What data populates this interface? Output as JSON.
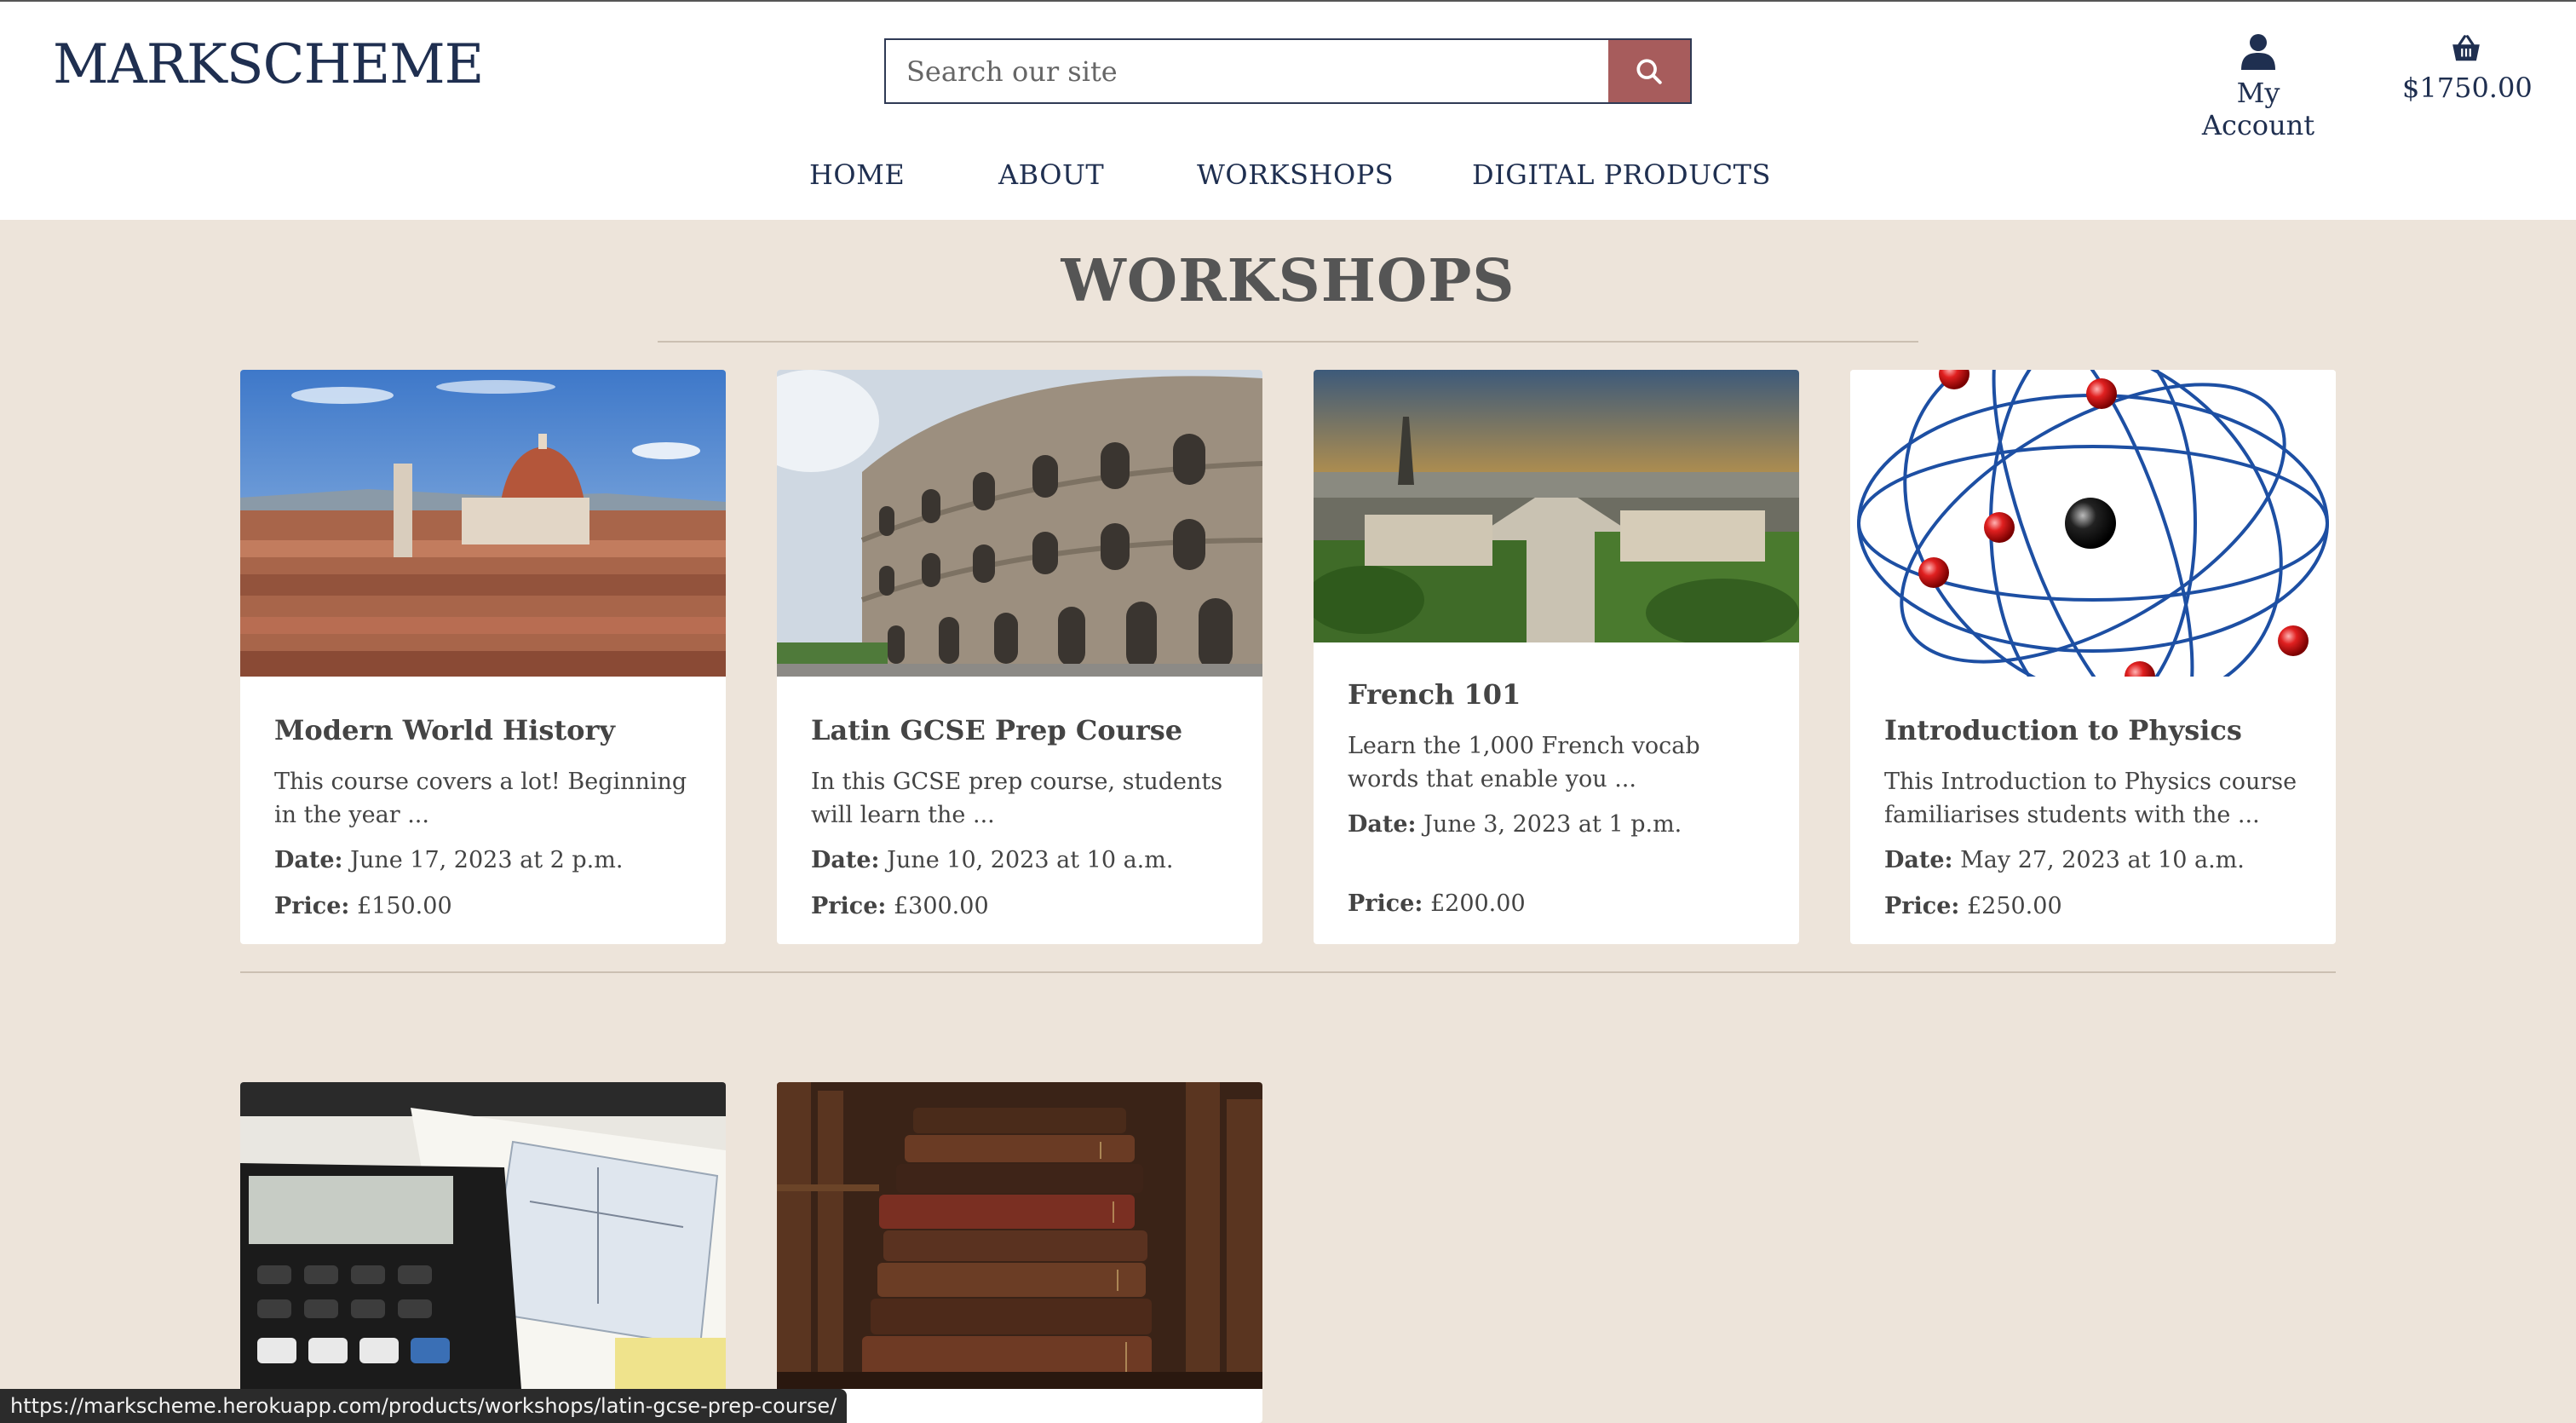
{
  "header": {
    "logo": "MARKSCHEME",
    "search_placeholder": "Search our site",
    "account_label": "My Account",
    "cart_total": "$1750.00"
  },
  "nav": [
    {
      "label": "HOME"
    },
    {
      "label": "ABOUT"
    },
    {
      "label": "WORKSHOPS"
    },
    {
      "label": "DIGITAL PRODUCTS"
    }
  ],
  "page_title": "WORKSHOPS",
  "date_label": "Date:",
  "price_label": "Price:",
  "workshops": [
    {
      "title": "Modern World History",
      "description": "This course covers a lot! Beginning in the year ...",
      "date": "June 17, 2023 at 2 p.m.",
      "price": "£150.00",
      "image": "florence-cityscape"
    },
    {
      "title": "Latin GCSE Prep Course",
      "description": "In this GCSE prep course, students will learn the ...",
      "date": "June 10, 2023 at 10 a.m.",
      "price": "£300.00",
      "image": "colosseum"
    },
    {
      "title": "French 101",
      "description": "Learn the 1,000 French vocab words that enable you ...",
      "date": "June 3, 2023 at 1 p.m.",
      "price": "£200.00",
      "image": "paris-skyline"
    },
    {
      "title": "Introduction to Physics",
      "description": "This Introduction to Physics course familiarises students with the ...",
      "date": "May 27, 2023 at 10 a.m.",
      "price": "£250.00",
      "image": "atom-model"
    },
    {
      "image": "calculator-textbook"
    },
    {
      "image": "stack-of-old-books"
    }
  ],
  "status_url": "https://markscheme.herokuapp.com/products/workshops/latin-gcse-prep-course/"
}
